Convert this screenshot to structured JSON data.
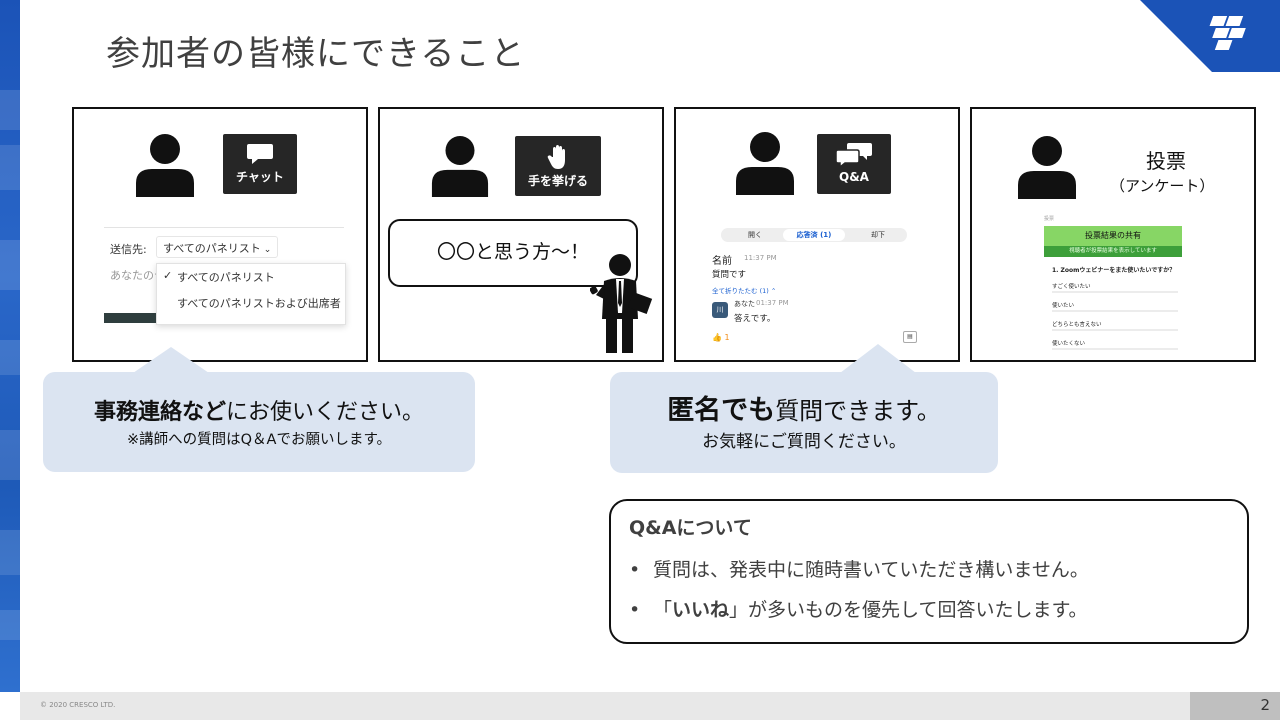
{
  "slide": {
    "title": "参加者の皆様にできること",
    "page_number": "2",
    "copyright": "© 2020 CRESCO LTD."
  },
  "panels": {
    "chat": {
      "button_label": "チャット",
      "send_to_label": "送信先:",
      "send_to_value": "すべてのパネリスト",
      "input_hint": "あなたのテ",
      "options": [
        "すべてのパネリスト",
        "すべてのパネリストおよび出席者"
      ]
    },
    "raise_hand": {
      "button_label": "手を挙げる",
      "speech": "〇〇と思う方～！"
    },
    "qa": {
      "button_label": "Q&A",
      "tabs": [
        "開く",
        "応答済 (1)",
        "却下"
      ],
      "question_author": "名前",
      "question_time": "11:37 PM",
      "question_text": "質問です",
      "collapse_label": "全て折りたたむ (1) ⌃",
      "answer_avatar": "川",
      "answer_author": "あなた",
      "answer_time": "01:37 PM",
      "answer_text": "答えです。",
      "like_count": "1"
    },
    "poll": {
      "title": "投票",
      "subtitle": "（アンケート）",
      "window_label": "投票",
      "header": "投票結果の共有",
      "subheader": "視聴者が投票結果を表示しています",
      "question": "1. Zoomウェビナーをまた使いたいですか？",
      "options": [
        "すごく使いたい",
        "使いたい",
        "どちらとも言えない",
        "使いたくない"
      ]
    }
  },
  "callouts": {
    "chat": {
      "strong": "事務連絡など",
      "rest": "にお使いください。",
      "note": "※講師への質問はQ＆Aでお願いします。"
    },
    "qa": {
      "strong": "匿名でも",
      "rest": "質問できます。",
      "note": "お気軽にご質問ください。"
    }
  },
  "about_qa": {
    "heading": "Q&Aについて",
    "bullet1": "質問は、発表中に随時書いていただき構いません。",
    "bullet2_pre": "「",
    "bullet2_strong": "いいね",
    "bullet2_post": "」が多いものを優先して回答いたします。"
  },
  "colors": {
    "accent_blue": "#1b53b7",
    "callout_bg": "#dbe4f1",
    "button_dark": "#262626",
    "poll_green": "#87d665"
  }
}
